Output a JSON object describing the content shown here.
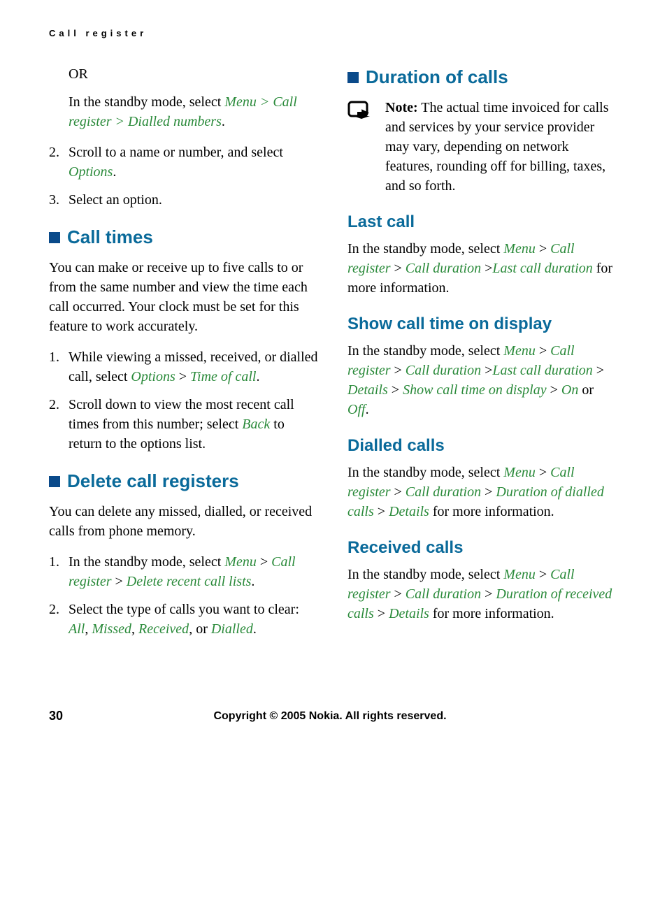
{
  "header": "Call register",
  "left": {
    "orText": "OR",
    "standbyIntro": "In the standby mode, select ",
    "standbyPath": "Menu > Call register > Dialled numbers",
    "step2text1": "Scroll to a name or number, and select ",
    "step2options": "Options",
    "step3": "Select an option.",
    "callTimesTitle": "Call times",
    "callTimesBody": "You can make or receive up to five calls to or from the same number and view the time each call occurred. Your clock must be set for this feature to work accurately.",
    "ct1a": "While viewing a missed, received, or dialled call, select ",
    "ct1b": "Options",
    "ct1c": " > ",
    "ct1d": "Time of call",
    "ct2a": "Scroll down to view the most recent call times from this number; select ",
    "ct2b": "Back",
    "ct2c": " to return to the options list.",
    "deleteTitle": "Delete call registers",
    "deleteBody": "You can delete any missed, dialled, or received calls from phone memory.",
    "del1a": "In the standby mode, select ",
    "del1b": "Menu",
    "del1c": " > ",
    "del1d": "Call register",
    "del1e": " > ",
    "del1f": "Delete recent call lists",
    "del2a": "Select the type of calls you want to clear: ",
    "del2b": "All",
    "del2c": ", ",
    "del2d": "Missed",
    "del2e": ", ",
    "del2f": "Received",
    "del2g": ", or ",
    "del2h": "Dialled"
  },
  "right": {
    "durationTitle": "Duration of calls",
    "noteLabel": "Note:",
    "noteBody": " The actual time invoiced for calls and services by your service provider may vary, depending on network features, rounding off for billing, taxes, and so forth.",
    "lastCallTitle": "Last call",
    "lastCall1": "In the standby mode, select ",
    "lastCall2": "Menu",
    "lastCall3": " > ",
    "lastCall4": "Call register",
    "lastCall5": " > ",
    "lastCall6": "Call duration",
    "lastCall7": " >",
    "lastCall8": "Last call duration",
    "lastCall9": " for more information.",
    "showTitle": "Show call time on display",
    "show1": "In the standby mode, select ",
    "show2": "Menu",
    "show3": " > ",
    "show4": "Call register",
    "show5": " > ",
    "show6": "Call duration",
    "show7": " >",
    "show8": "Last call duration",
    "show9": " > ",
    "show10": "Details",
    "show11": " > ",
    "show12": "Show call time on display",
    "show13": " > ",
    "show14": "On",
    "show15": " or ",
    "show16": "Off",
    "dialledTitle": "Dialled calls",
    "d1": "In the standby mode, select ",
    "d2": "Menu",
    "d3": " > ",
    "d4": "Call register",
    "d5": " > ",
    "d6": "Call duration",
    "d7": " > ",
    "d8": "Duration of dialled calls",
    "d9": " > ",
    "d10": "Details",
    "d11": " for more information.",
    "receivedTitle": "Received calls",
    "r1": "In the standby mode, select ",
    "r2": "Menu",
    "r3": " > ",
    "r4": "Call register",
    "r5": " > ",
    "r6": "Call duration",
    "r7": " > ",
    "r8": "Duration of received calls",
    "r9": " > ",
    "r10": "Details",
    "r11": " for more information."
  },
  "footer": {
    "pageNum": "30",
    "copyright": "Copyright © 2005 Nokia. All rights reserved."
  }
}
